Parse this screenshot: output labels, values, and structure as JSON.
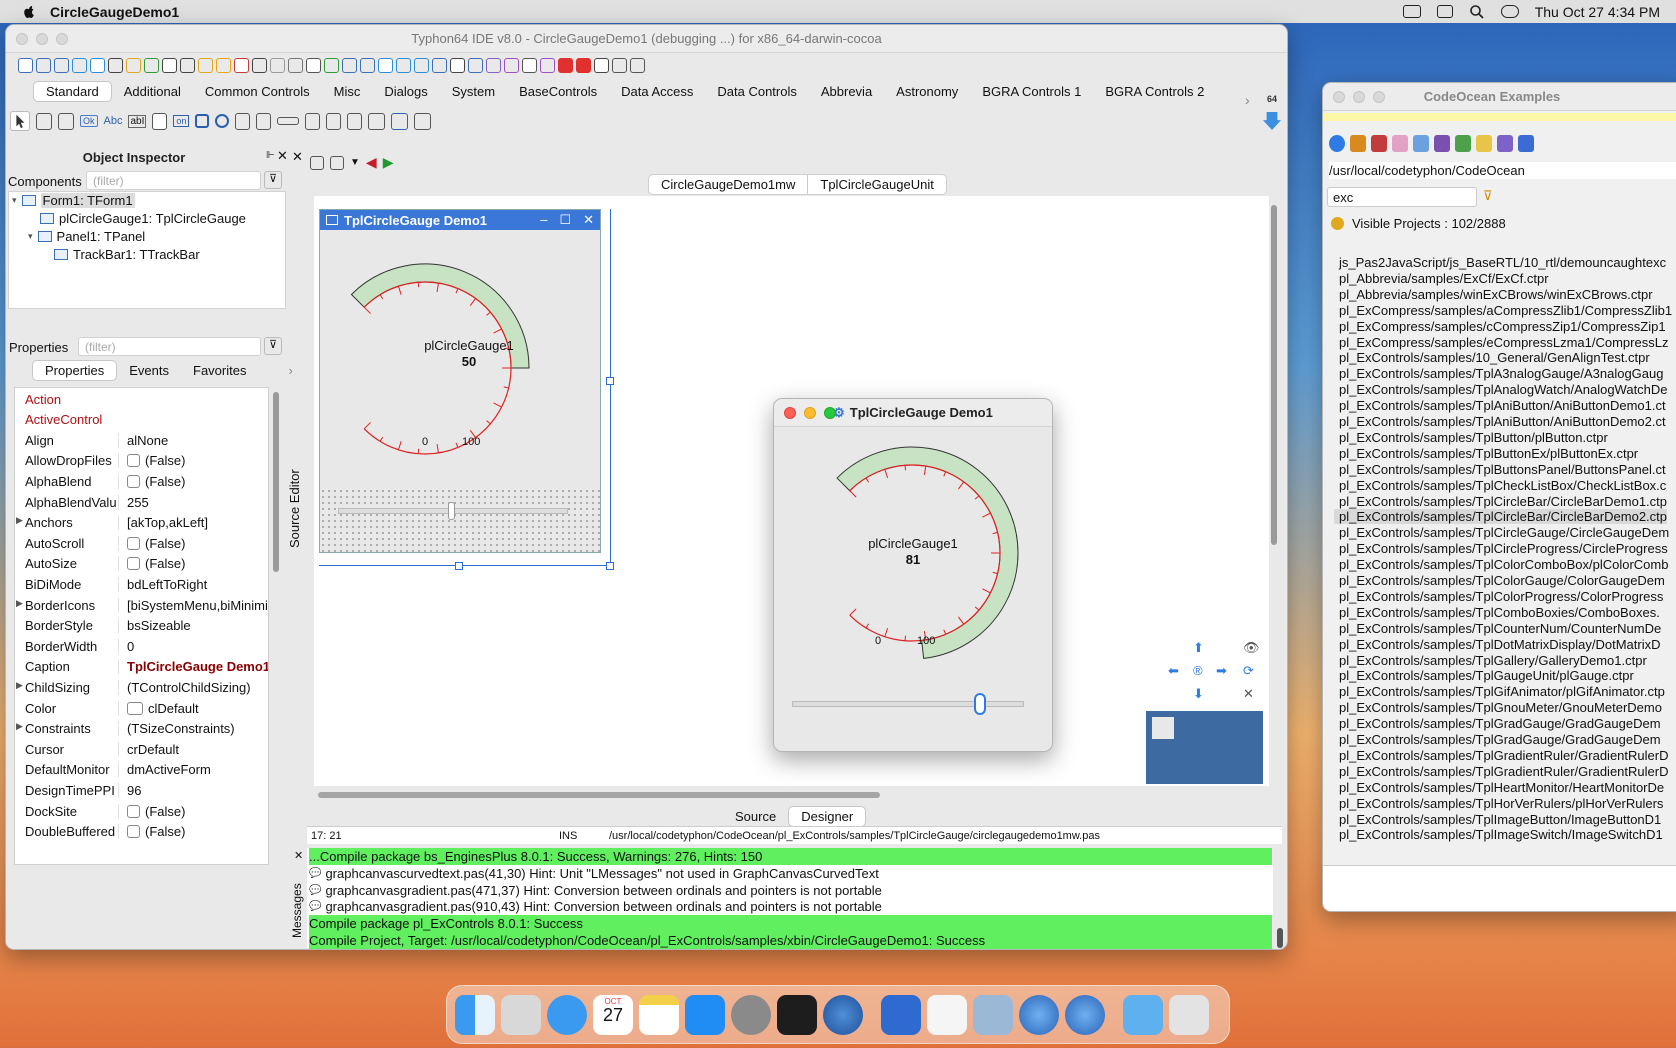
{
  "menubar": {
    "app_name": "CircleGaugeDemo1",
    "datetime": "Thu Oct 27  4:34 PM"
  },
  "ide": {
    "title": "Typhon64 IDE v8.0 - CircleGaugeDemo1 (debugging ...) for x86_64-darwin-cocoa",
    "palette_tabs": [
      "Standard",
      "Additional",
      "Common Controls",
      "Misc",
      "Dialogs",
      "System",
      "BaseControls",
      "Data Access",
      "Data Controls",
      "Abbrevia",
      "Astronomy",
      "BGRA Controls 1",
      "BGRA Controls 2"
    ],
    "palette_tab_active": "Standard",
    "palette_64": "64",
    "palette_items": [
      "Ok",
      "Abc",
      "abI",
      "on"
    ]
  },
  "object_inspector": {
    "title": "Object Inspector",
    "components_label": "Components",
    "components_filter_placeholder": "(filter)",
    "tree": [
      "Form1: TForm1",
      "plCircleGauge1: TplCircleGauge",
      "Panel1: TPanel",
      "TrackBar1: TTrackBar"
    ],
    "properties_label": "Properties",
    "properties_filter_placeholder": "(filter)",
    "tabs": [
      "Properties",
      "Events",
      "Favorites"
    ],
    "rows": [
      {
        "name": "Action",
        "value": "",
        "red": true
      },
      {
        "name": "ActiveControl",
        "value": "",
        "red": true
      },
      {
        "name": "Align",
        "value": "alNone"
      },
      {
        "name": "AllowDropFiles",
        "value": "(False)",
        "check": true
      },
      {
        "name": "AlphaBlend",
        "value": "(False)",
        "check": true
      },
      {
        "name": "AlphaBlendValu",
        "value": "255"
      },
      {
        "name": "Anchors",
        "value": "[akTop,akLeft]",
        "expand": true
      },
      {
        "name": "AutoScroll",
        "value": "(False)",
        "check": true
      },
      {
        "name": "AutoSize",
        "value": "(False)",
        "check": true
      },
      {
        "name": "BiDiMode",
        "value": "bdLeftToRight"
      },
      {
        "name": "BorderIcons",
        "value": "[biSystemMenu,biMinimi",
        "expand": true
      },
      {
        "name": "BorderStyle",
        "value": "bsSizeable"
      },
      {
        "name": "BorderWidth",
        "value": "0"
      },
      {
        "name": "Caption",
        "value": "TplCircleGauge Demo1",
        "caption": true
      },
      {
        "name": "ChildSizing",
        "value": "(TControlChildSizing)",
        "expand": true
      },
      {
        "name": "Color",
        "value": "clDefault",
        "swatch": true
      },
      {
        "name": "Constraints",
        "value": "(TSizeConstraints)",
        "expand": true
      },
      {
        "name": "Cursor",
        "value": "crDefault"
      },
      {
        "name": "DefaultMonitor",
        "value": "dmActiveForm"
      },
      {
        "name": "DesignTimePPI",
        "value": "96"
      },
      {
        "name": "DockSite",
        "value": "(False)",
        "check": true
      },
      {
        "name": "DoubleBuffered",
        "value": "(False)",
        "check": true
      }
    ]
  },
  "source_editor": {
    "side_label": "Source Editor",
    "tabs": [
      "CircleGaugeDemo1mw",
      "TplCircleGaugeUnit"
    ],
    "bottom_tabs": [
      "Source",
      "Designer"
    ],
    "active_bottom_tab": "Designer",
    "status": {
      "cursor": "17:  21",
      "mode": "INS",
      "path": "/usr/local/codetyphon/CodeOcean/pl_ExControls/samples/TplCircleGauge/circlegaugedemo1mw.pas"
    }
  },
  "design_form": {
    "caption": "TplCircleGauge Demo1",
    "gauge_name": "plCircleGauge1",
    "gauge_value": "50",
    "gauge_value_num": 50,
    "min_label": "0",
    "max_label": "100"
  },
  "running_form": {
    "caption": "TplCircleGauge Demo1",
    "gauge_name": "plCircleGauge1",
    "gauge_value": "81",
    "gauge_value_num": 81,
    "min_label": "0",
    "max_label": "100"
  },
  "messages": {
    "side_label": "Messages",
    "lines": [
      {
        "text": "...Compile package bs_EnginesPlus 8.0.1: Success, Warnings: 276, Hints: 150",
        "green": true
      },
      {
        "text": "graphcanvascurvedtext.pas(41,30) Hint: Unit \"LMessages\" not used in GraphCanvasCurvedText",
        "green": false
      },
      {
        "text": "graphcanvasgradient.pas(471,37) Hint: Conversion between ordinals and pointers is not portable",
        "green": false
      },
      {
        "text": "graphcanvasgradient.pas(910,43) Hint: Conversion between ordinals and pointers is not portable",
        "green": false
      },
      {
        "text": "Compile package pl_ExControls 8.0.1: Success",
        "green": true
      },
      {
        "text": "Compile Project, Target: /usr/local/codetyphon/CodeOcean/pl_ExControls/samples/xbin/CircleGaugeDemo1: Success",
        "green": true
      }
    ]
  },
  "codeocean": {
    "title": "CodeOcean Examples",
    "path": "/usr/local/codetyphon/CodeOcean",
    "filter": "exc",
    "visible_projects": "Visible Projects : 102/2888",
    "selected_index": 16,
    "items": [
      "js_Pas2JavaScript/js_BaseRTL/10_rtl/demouncaughtexc",
      "pl_Abbrevia/samples/ExCf/ExCf.ctpr",
      "pl_Abbrevia/samples/winExCBrows/winExCBrows.ctpr",
      "pl_ExCompress/samples/aCompressZlib1/CompressZlib1",
      "pl_ExCompress/samples/cCompressZip1/CompressZip1",
      "pl_ExCompress/samples/eCompressLzma1/CompressLz",
      "pl_ExControls/samples/10_General/GenAlignTest.ctpr",
      "pl_ExControls/samples/TplA3nalogGauge/A3nalogGaug",
      "pl_ExControls/samples/TplAnalogWatch/AnalogWatchDe",
      "pl_ExControls/samples/TplAniButton/AniButtonDemo1.ct",
      "pl_ExControls/samples/TplAniButton/AniButtonDemo2.ct",
      "pl_ExControls/samples/TplButton/plButton.ctpr",
      "pl_ExControls/samples/TplButtonEx/plButtonEx.ctpr",
      "pl_ExControls/samples/TplButtonsPanel/ButtonsPanel.ct",
      "pl_ExControls/samples/TplCheckListBox/CheckListBox.c",
      "pl_ExControls/samples/TplCircleBar/CircleBarDemo1.ctp",
      "pl_ExControls/samples/TplCircleBar/CircleBarDemo2.ctp",
      "pl_ExControls/samples/TplCircleGauge/CircleGaugeDem",
      "pl_ExControls/samples/TplCircleProgress/CircleProgress",
      "pl_ExControls/samples/TplColorComboBox/plColorComb",
      "pl_ExControls/samples/TplColorGauge/ColorGaugeDem",
      "pl_ExControls/samples/TplColorProgress/ColorProgress",
      "pl_ExControls/samples/TplComboBoxies/ComboBoxes.",
      "pl_ExControls/samples/TplCounterNum/CounterNumDe",
      "pl_ExControls/samples/TplDotMatrixDisplay/DotMatrixD",
      "pl_ExControls/samples/TplGallery/GalleryDemo1.ctpr",
      "pl_ExControls/samples/TplGaugeUnit/plGauge.ctpr",
      "pl_ExControls/samples/TplGifAnimator/plGifAnimator.ctp",
      "pl_ExControls/samples/TplGnouMeter/GnouMeterDemo",
      "pl_ExControls/samples/TplGradGauge/GradGaugeDem",
      "pl_ExControls/samples/TplGradGauge/GradGaugeDem",
      "pl_ExControls/samples/TplGradientRuler/GradientRulerD",
      "pl_ExControls/samples/TplGradientRuler/GradientRulerD",
      "pl_ExControls/samples/TplHeartMonitor/HeartMonitorDe",
      "pl_ExControls/samples/TplHorVerRulers/plHorVerRulers",
      "pl_ExControls/samples/TplImageButton/ImageButtonD1",
      "pl_ExControls/samples/TplImageSwitch/ImageSwitchD1"
    ]
  },
  "dock": {
    "calendar_month": "OCT",
    "calendar_day": "27"
  }
}
